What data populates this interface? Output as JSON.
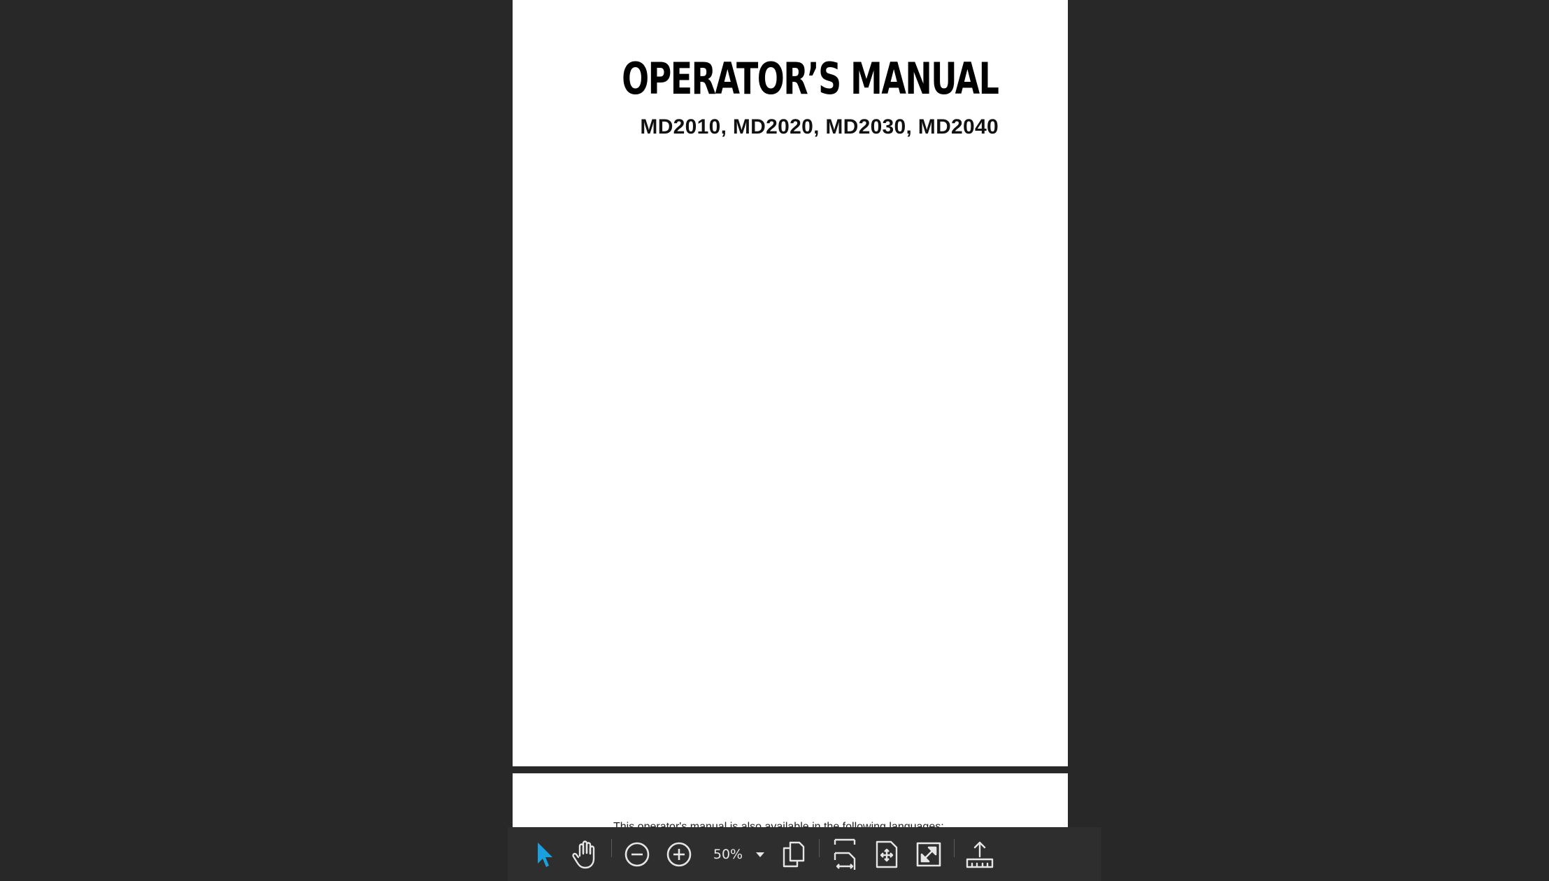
{
  "document": {
    "title": "OPERATOR’S MANUAL",
    "subtitle": "MD2010, MD2020, MD2030, MD2040",
    "page2_text": "This operator's manual is also available in the following languages:"
  },
  "toolbar": {
    "zoom_value": "50%",
    "accent_color": "#1a9fe0",
    "icon_color": "#e6e6e6",
    "tools": [
      {
        "name": "select-tool",
        "icon": "arrow-cursor-icon",
        "active": true
      },
      {
        "name": "pan-tool",
        "icon": "hand-icon",
        "active": false
      },
      {
        "name": "zoom-out",
        "icon": "minus-circle-icon"
      },
      {
        "name": "zoom-in",
        "icon": "plus-circle-icon"
      },
      {
        "name": "page-view",
        "icon": "pages-icon"
      },
      {
        "name": "fit-width",
        "icon": "fit-width-icon"
      },
      {
        "name": "fit-page",
        "icon": "fit-page-icon"
      },
      {
        "name": "fullscreen",
        "icon": "expand-icon"
      },
      {
        "name": "export",
        "icon": "upload-icon"
      }
    ]
  }
}
